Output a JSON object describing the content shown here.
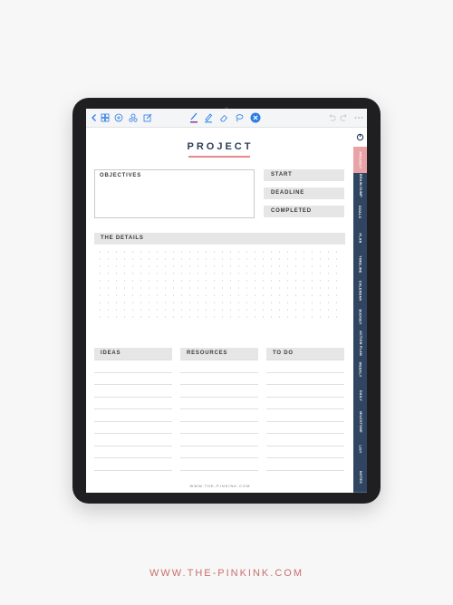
{
  "page": {
    "title": "PROJECT",
    "objectives_label": "OBJECTIVES",
    "fields": [
      "START",
      "DEADLINE",
      "COMPLETED"
    ],
    "details_label": "THE DETAILS",
    "columns": [
      "IDEAS",
      "RESOURCES",
      "TO DO"
    ],
    "footer": "WWW.THE-PINKINK.COM"
  },
  "tabs": [
    "PROJECT",
    "BRAIN DUMP",
    "GOALS",
    "PLAN",
    "TIMELINE",
    "CALENDAR",
    "BUDGET",
    "ACTION PLAN",
    "WEEKLY",
    "DAILY",
    "MILESTONE",
    "LIST",
    "NOTES"
  ],
  "toolbar": {
    "back_icon": "back-icon",
    "grid_icon": "grid-icon",
    "add_icon": "add-icon",
    "shapes_icon": "shapes-icon",
    "edit_icon": "edit-icon",
    "pen_icon": "pen-icon",
    "highlighter_icon": "highlighter-icon",
    "eraser_icon": "eraser-icon",
    "lasso_icon": "lasso-icon",
    "close_icon": "close-icon"
  },
  "caption": "WWW.THE-PINKINK.COM",
  "colors": {
    "navy": "#2f4562",
    "pink": "#e9a2a6",
    "accent_blue": "#2a7be4",
    "caption": "#c8706f"
  }
}
